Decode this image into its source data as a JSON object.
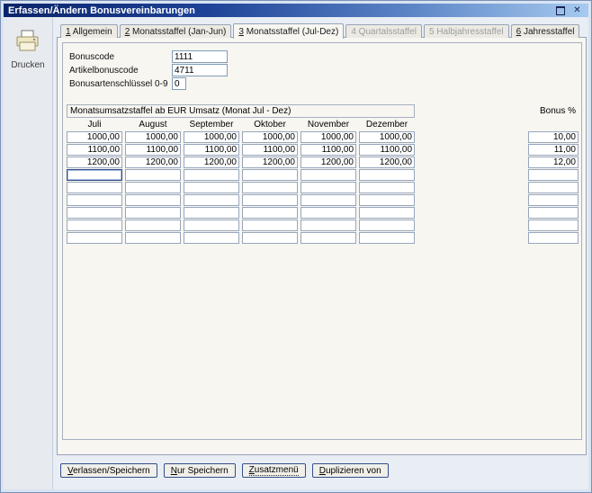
{
  "window": {
    "title": "Erfassen/Ändern Bonusvereinbarungen",
    "close_glyph": "✕"
  },
  "sidebar": {
    "print_label": "Drucken"
  },
  "tabs": [
    {
      "id": "allgemein",
      "hotkey": "1",
      "rest": " Allgemein",
      "active": false,
      "disabled": false
    },
    {
      "id": "monatsstaffel-jan-jun",
      "hotkey": "2",
      "rest": " Monatsstaffel (Jan-Jun)",
      "active": false,
      "disabled": false
    },
    {
      "id": "monatsstaffel-jul-dez",
      "hotkey": "3",
      "rest": " Monatsstaffel (Jul-Dez)",
      "active": true,
      "disabled": false
    },
    {
      "id": "quartalsstaffel",
      "hotkey": "4",
      "rest": " Quartalsstaffel",
      "active": false,
      "disabled": true
    },
    {
      "id": "halbjahresstaffel",
      "hotkey": "5",
      "rest": " Halbjahresstaffel",
      "active": false,
      "disabled": true
    },
    {
      "id": "jahresstaffel",
      "hotkey": "6",
      "rest": " Jahresstaffel",
      "active": false,
      "disabled": false
    }
  ],
  "form": {
    "fields": [
      {
        "label": "Bonuscode",
        "value": "1111"
      },
      {
        "label": "Artikelbonuscode",
        "value": "4711"
      },
      {
        "label": "Bonusartenschlüssel 0-9",
        "value": "0"
      }
    ]
  },
  "table": {
    "caption": "Monatsumsatzstaffel ab EUR Umsatz (Monat Jul - Dez)",
    "bonus_header": "Bonus %",
    "columns": [
      "Juli",
      "August",
      "September",
      "Oktober",
      "November",
      "Dezember"
    ],
    "rows": [
      {
        "months": [
          "1000,00",
          "1000,00",
          "1000,00",
          "1000,00",
          "1000,00",
          "1000,00"
        ],
        "bonus": "10,00"
      },
      {
        "months": [
          "1100,00",
          "1100,00",
          "1100,00",
          "1100,00",
          "1100,00",
          "1100,00"
        ],
        "bonus": "11,00"
      },
      {
        "months": [
          "1200,00",
          "1200,00",
          "1200,00",
          "1200,00",
          "1200,00",
          "1200,00"
        ],
        "bonus": "12,00"
      },
      {
        "months": [
          "",
          "",
          "",
          "",
          "",
          ""
        ],
        "bonus": ""
      },
      {
        "months": [
          "",
          "",
          "",
          "",
          "",
          ""
        ],
        "bonus": ""
      },
      {
        "months": [
          "",
          "",
          "",
          "",
          "",
          ""
        ],
        "bonus": ""
      },
      {
        "months": [
          "",
          "",
          "",
          "",
          "",
          ""
        ],
        "bonus": ""
      },
      {
        "months": [
          "",
          "",
          "",
          "",
          "",
          ""
        ],
        "bonus": ""
      },
      {
        "months": [
          "",
          "",
          "",
          "",
          "",
          ""
        ],
        "bonus": ""
      }
    ],
    "focus": {
      "row": 3,
      "col": 0
    }
  },
  "buttons": [
    {
      "name": "verlassen-speichern-button",
      "hotkey": "V",
      "rest": "erlassen/Speichern",
      "menu": false
    },
    {
      "name": "nur-speichern-button",
      "hotkey": "N",
      "rest": "ur Speichern",
      "menu": false
    },
    {
      "name": "zusatzmenu-button",
      "hotkey": "Z",
      "rest": "usatzmenü",
      "menu": true
    },
    {
      "name": "duplizieren-von-button",
      "hotkey": "D",
      "rest": "uplizieren von",
      "menu": false
    }
  ],
  "colors": {
    "titlebar_start": "#0a246a",
    "titlebar_end": "#a6caf0",
    "input_border": "#7f9db9",
    "button_border": "#33508c",
    "page_background": "#f7f6f1"
  }
}
